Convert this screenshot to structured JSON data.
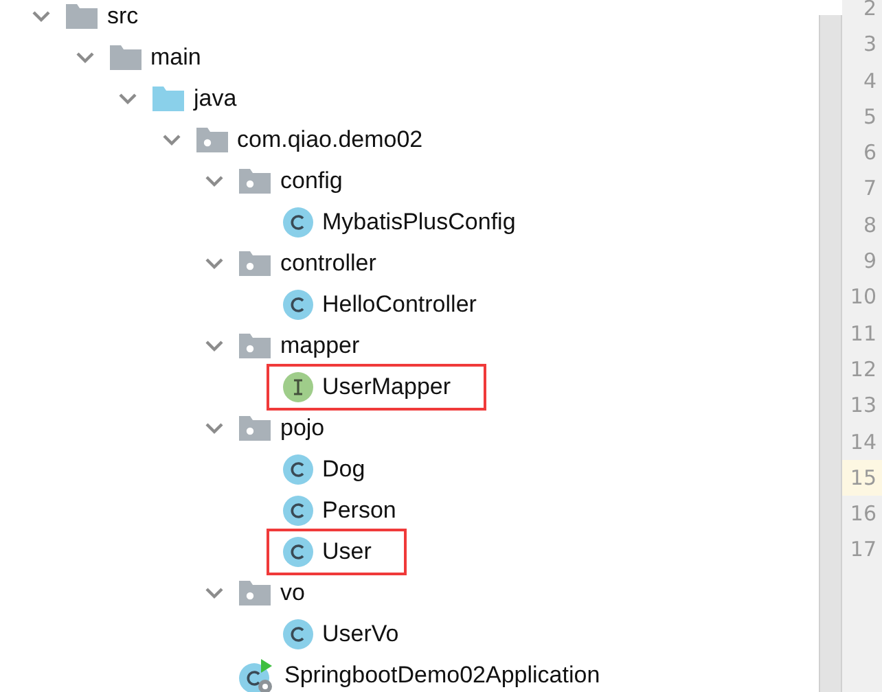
{
  "tree": [
    {
      "label": "src",
      "kind": "folder",
      "expanded": true,
      "children": [
        {
          "label": "main",
          "kind": "folder",
          "expanded": true,
          "children": [
            {
              "label": "java",
              "kind": "source-folder",
              "expanded": true,
              "children": [
                {
                  "label": "com.qiao.demo02",
                  "kind": "package",
                  "expanded": true,
                  "children": [
                    {
                      "label": "config",
                      "kind": "package",
                      "expanded": true,
                      "children": [
                        {
                          "label": "MybatisPlusConfig",
                          "kind": "class",
                          "highlighted": false
                        }
                      ]
                    },
                    {
                      "label": "controller",
                      "kind": "package",
                      "expanded": true,
                      "children": [
                        {
                          "label": "HelloController",
                          "kind": "class",
                          "highlighted": false
                        }
                      ]
                    },
                    {
                      "label": "mapper",
                      "kind": "package",
                      "expanded": true,
                      "children": [
                        {
                          "label": "UserMapper",
                          "kind": "interface",
                          "highlighted": true
                        }
                      ]
                    },
                    {
                      "label": "pojo",
                      "kind": "package",
                      "expanded": true,
                      "children": [
                        {
                          "label": "Dog",
                          "kind": "class",
                          "highlighted": false
                        },
                        {
                          "label": "Person",
                          "kind": "class",
                          "highlighted": false
                        },
                        {
                          "label": "User",
                          "kind": "class",
                          "highlighted": true
                        }
                      ]
                    },
                    {
                      "label": "vo",
                      "kind": "package",
                      "expanded": true,
                      "children": [
                        {
                          "label": "UserVo",
                          "kind": "class",
                          "highlighted": false
                        }
                      ]
                    },
                    {
                      "label": "SpringbootDemo02Application",
                      "kind": "application",
                      "highlighted": false
                    }
                  ]
                }
              ]
            }
          ]
        }
      ]
    }
  ],
  "gutter": {
    "lines": [
      {
        "number": "2",
        "current": false
      },
      {
        "number": "3",
        "current": false
      },
      {
        "number": "4",
        "current": false
      },
      {
        "number": "5",
        "current": false
      },
      {
        "number": "6",
        "current": false
      },
      {
        "number": "7",
        "current": false
      },
      {
        "number": "8",
        "current": false
      },
      {
        "number": "9",
        "current": false
      },
      {
        "number": "10",
        "current": false
      },
      {
        "number": "11",
        "current": false
      },
      {
        "number": "12",
        "current": false
      },
      {
        "number": "13",
        "current": false
      },
      {
        "number": "14",
        "current": false
      },
      {
        "number": "15",
        "current": true
      },
      {
        "number": "16",
        "current": false
      },
      {
        "number": "17",
        "current": false
      }
    ]
  }
}
